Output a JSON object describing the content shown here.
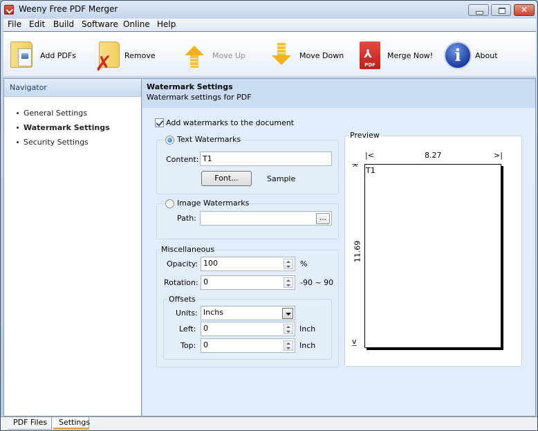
{
  "window": {
    "title": "Weeny Free PDF Merger",
    "controls": {
      "minimize": "minimize",
      "maximize": "maximize",
      "close": "✕"
    }
  },
  "menu": [
    "File",
    "Edit",
    "Build",
    "Software",
    "Online",
    "Help"
  ],
  "toolbar": {
    "add_pdfs": "Add PDFs",
    "remove": "Remove",
    "move_up": "Move Up",
    "move_down": "Move Down",
    "merge_now": "Merge Now!",
    "about": "About",
    "pdf_icon_label": "PDF",
    "about_icon_glyph": "i",
    "remove_icon_glyph": "✗"
  },
  "navigator": {
    "title": "Navigator",
    "items": [
      {
        "label": "General Settings",
        "active": false
      },
      {
        "label": "Watermark Settings",
        "active": true
      },
      {
        "label": "Security Settings",
        "active": false
      }
    ]
  },
  "main": {
    "title": "Watermark Settings",
    "subtitle": "Watermark settings for PDF",
    "add_watermarks_label": "Add watermarks to the document",
    "add_watermarks_checked": true,
    "text_watermarks": {
      "label": "Text Watermarks",
      "selected": true,
      "content_label": "Content:",
      "content_value": "T1",
      "font_button": "Font...",
      "sample_label": "Sample"
    },
    "image_watermarks": {
      "label": "Image Watermarks",
      "selected": false,
      "path_label": "Path:",
      "path_value": "",
      "browse_button": "..."
    },
    "miscellaneous": {
      "label": "Miscellaneous",
      "opacity_label": "Opacity:",
      "opacity_value": "100",
      "opacity_unit": "%",
      "rotation_label": "Rotation:",
      "rotation_value": "0",
      "rotation_range": "-90 ~ 90"
    },
    "offsets": {
      "label": "Offsets",
      "units_label": "Units:",
      "units_value": "Inchs",
      "left_label": "Left:",
      "left_value": "0",
      "left_unit": "Inch",
      "top_label": "Top:",
      "top_value": "0",
      "top_unit": "Inch"
    },
    "preview": {
      "label": "Preview",
      "width_value": "8.27",
      "height_value": "11.69",
      "left_marker": "|<",
      "right_marker": ">|",
      "top_marker": "^",
      "bottom_marker": "v",
      "watermark_text": "T1"
    }
  },
  "bottom_tabs": [
    {
      "label": "PDF Files",
      "active": false
    },
    {
      "label": "Settings",
      "active": true
    }
  ]
}
